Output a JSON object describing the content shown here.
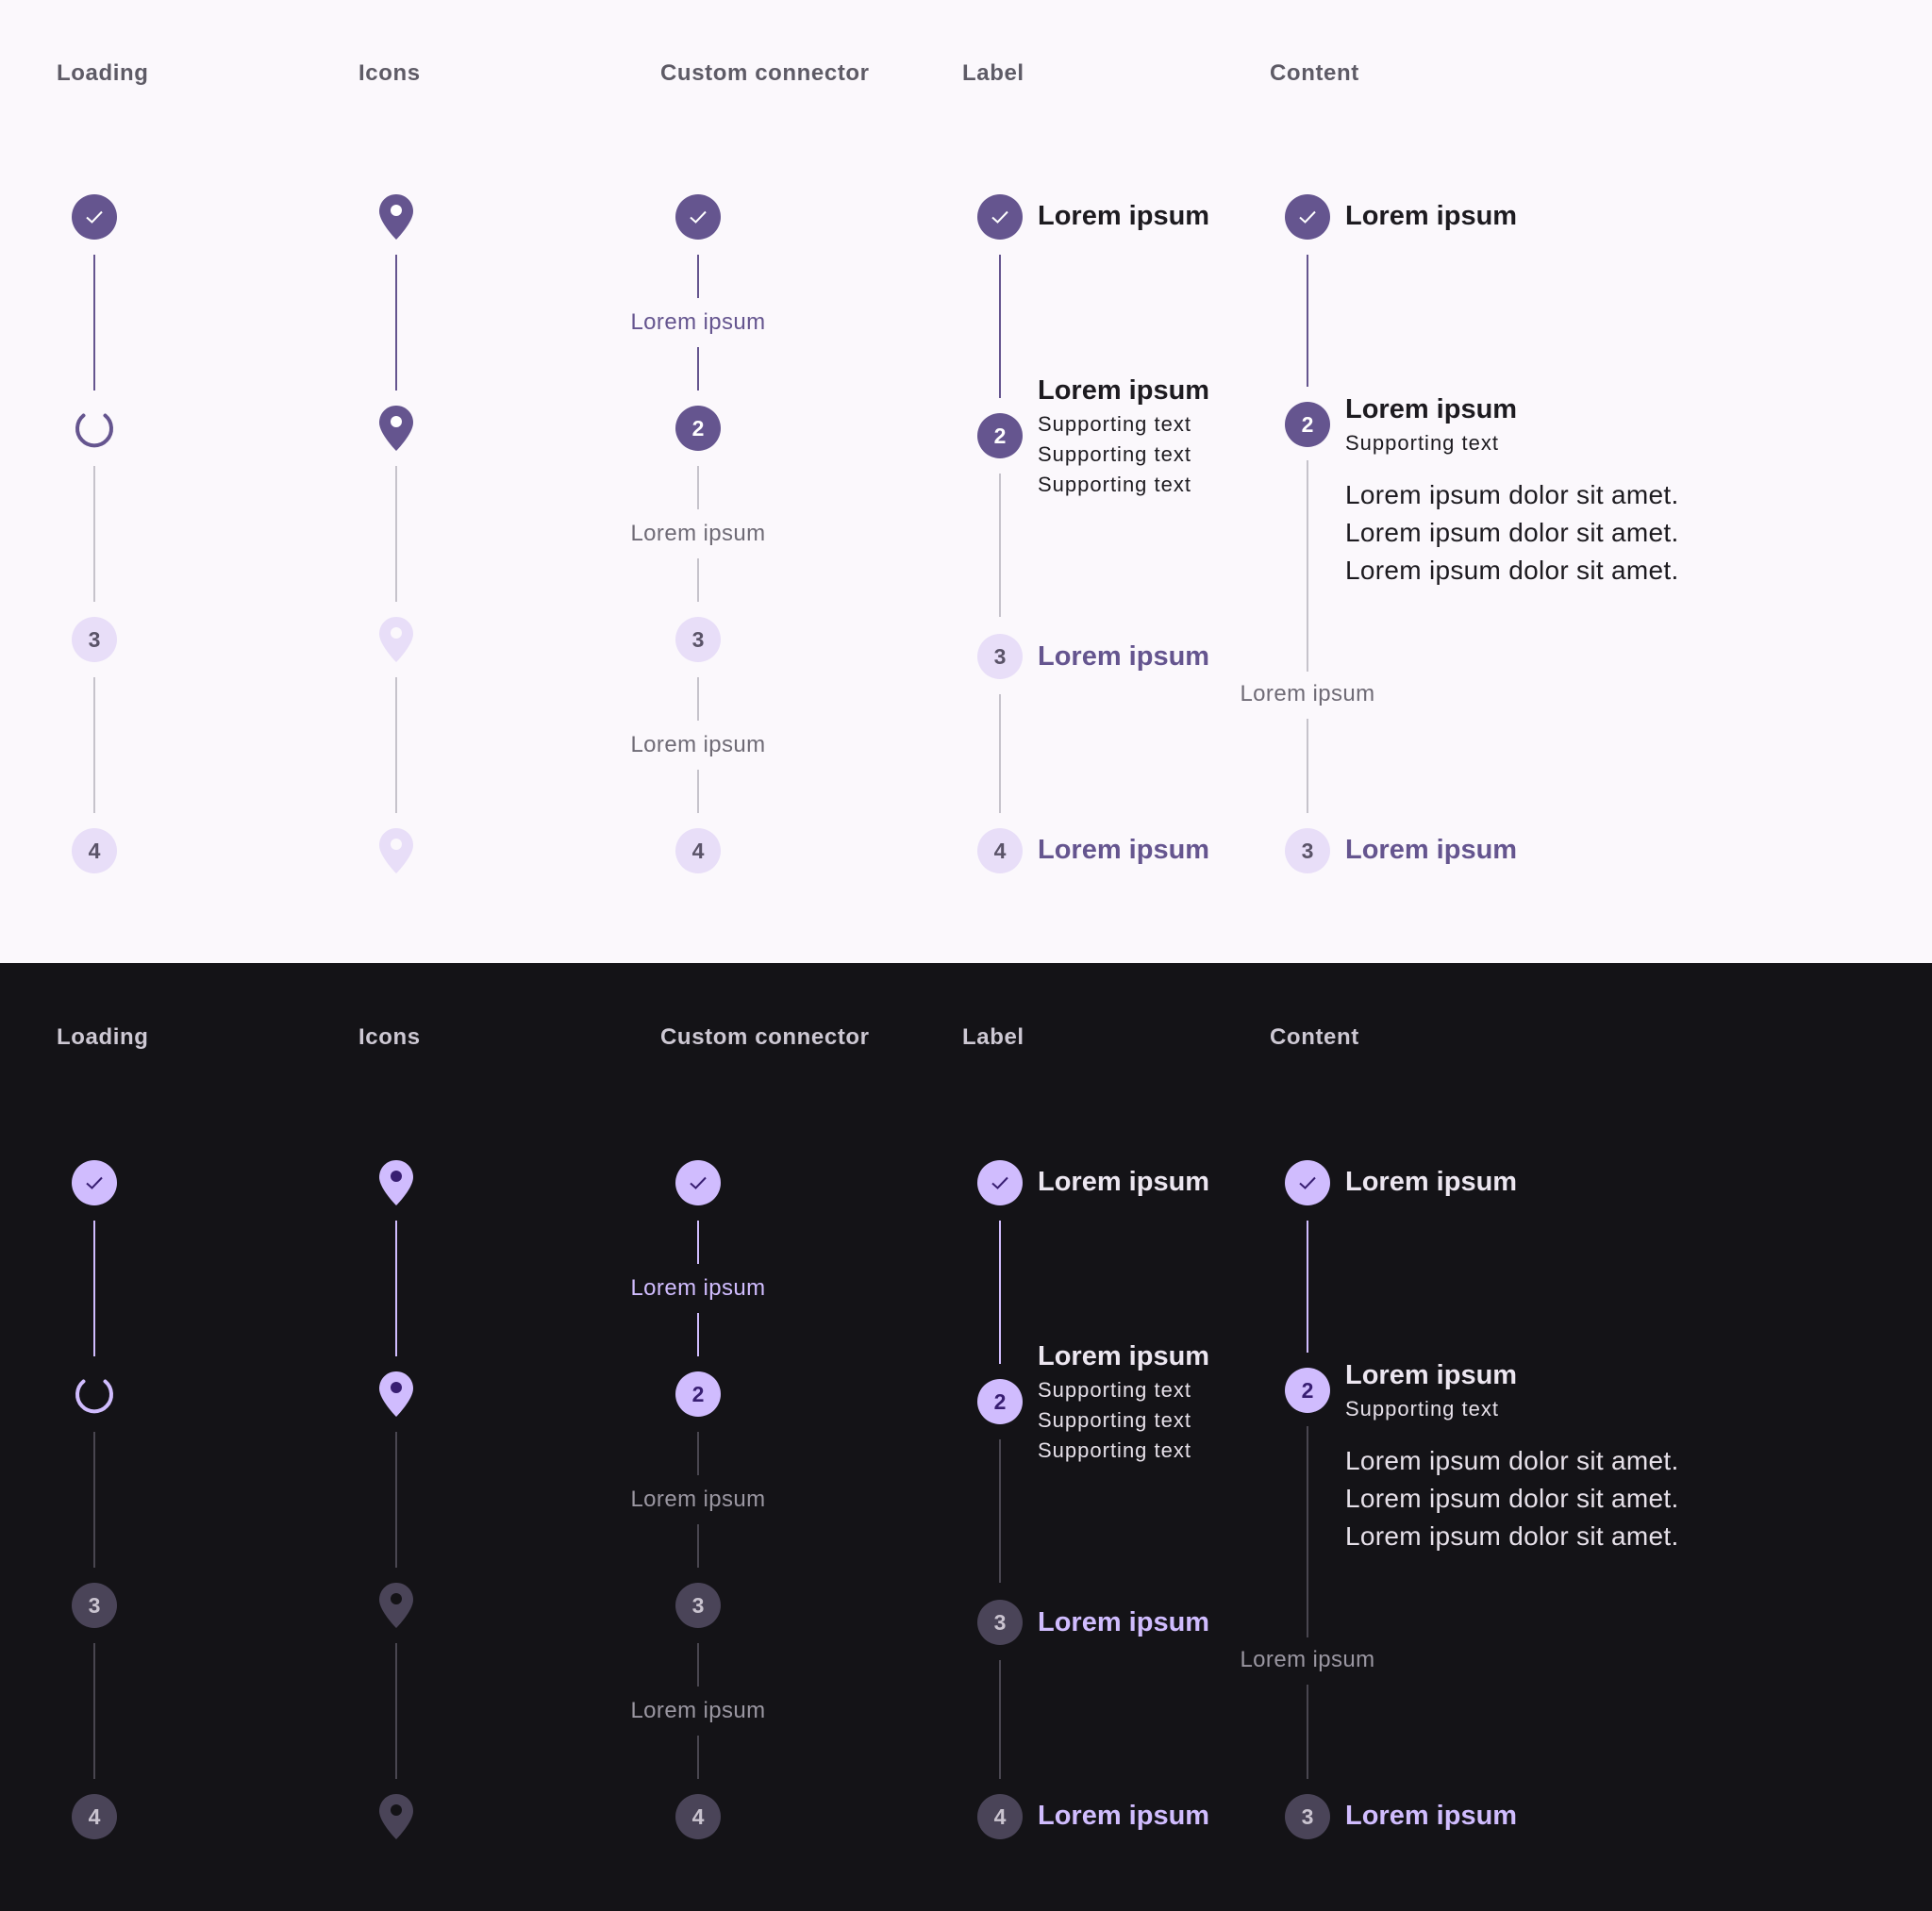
{
  "columns": {
    "loading": "Loading",
    "icons": "Icons",
    "custom_connector": "Custom connector",
    "label": "Label",
    "content": "Content"
  },
  "steps": {
    "step_2": "2",
    "step_3": "3",
    "step_4": "4"
  },
  "custom_connector_labels": [
    "Lorem ipsum",
    "Lorem ipsum",
    "Lorem ipsum"
  ],
  "label_steps": {
    "titles": [
      "Lorem ipsum",
      "Lorem ipsum",
      "Lorem ipsum",
      "Lorem ipsum"
    ],
    "supporting": [
      "Supporting text",
      "Supporting text",
      "Supporting text"
    ]
  },
  "content_steps": {
    "titles": [
      "Lorem ipsum",
      "Lorem ipsum",
      "Lorem ipsum"
    ],
    "supporting": "Supporting text",
    "body": [
      "Lorem ipsum dolor sit amet.",
      "Lorem ipsum dolor sit amet.",
      "Lorem ipsum dolor sit amet."
    ],
    "connector_label": "Lorem ipsum"
  },
  "themes": {
    "light": {
      "background": "#fbf8fc",
      "primary": "#65558f",
      "on_primary": "#ffffff",
      "inactive_container": "#e8def8",
      "inactive_connector": "#c6c3cb"
    },
    "dark": {
      "background": "#141317",
      "primary": "#d0bcfe",
      "on_primary": "#381e72",
      "inactive_container": "#4a4458",
      "inactive_connector": "#494650"
    }
  },
  "icons": [
    "check-icon",
    "loading-spinner-icon",
    "location-pin-icon"
  ]
}
